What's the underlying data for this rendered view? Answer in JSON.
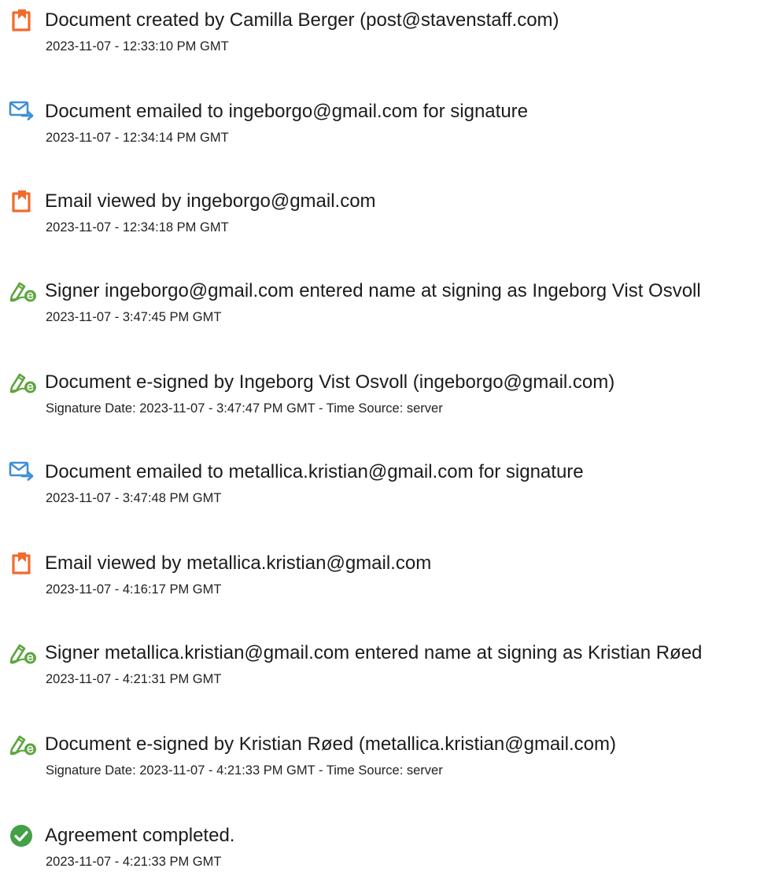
{
  "colors": {
    "doc_icon": "#f26b2c",
    "mail_icon": "#3e8fd6",
    "sign_icon": "#5fa540",
    "check_icon": "#43a047"
  },
  "entries": [
    {
      "icon": "document-icon",
      "title": "Document created by Camilla Berger (post@stavenstaff.com)",
      "detail": "2023-11-07 - 12:33:10 PM GMT"
    },
    {
      "icon": "email-sent-icon",
      "title": "Document emailed to ingeborgo@gmail.com for signature",
      "detail": "2023-11-07 - 12:34:14 PM GMT"
    },
    {
      "icon": "document-icon",
      "title": "Email viewed by ingeborgo@gmail.com",
      "detail": "2023-11-07 - 12:34:18 PM GMT"
    },
    {
      "icon": "esign-pen-icon",
      "title": "Signer ingeborgo@gmail.com entered name at signing as Ingeborg Vist Osvoll",
      "detail": "2023-11-07 - 3:47:45 PM GMT"
    },
    {
      "icon": "esign-pen-icon",
      "title": "Document e-signed by Ingeborg Vist Osvoll (ingeborgo@gmail.com)",
      "detail": "Signature Date: 2023-11-07 - 3:47:47 PM GMT - Time Source: server"
    },
    {
      "icon": "email-sent-icon",
      "title": "Document emailed to metallica.kristian@gmail.com for signature",
      "detail": "2023-11-07 - 3:47:48 PM GMT"
    },
    {
      "icon": "document-icon",
      "title": "Email viewed by metallica.kristian@gmail.com",
      "detail": "2023-11-07 - 4:16:17 PM GMT"
    },
    {
      "icon": "esign-pen-icon",
      "title": "Signer metallica.kristian@gmail.com entered name at signing as Kristian Røed",
      "detail": "2023-11-07 - 4:21:31 PM GMT"
    },
    {
      "icon": "esign-pen-icon",
      "title": "Document e-signed by Kristian Røed (metallica.kristian@gmail.com)",
      "detail": "Signature Date: 2023-11-07 - 4:21:33 PM GMT - Time Source: server"
    },
    {
      "icon": "checkmark-circle-icon",
      "title": "Agreement completed.",
      "detail": "2023-11-07 - 4:21:33 PM GMT"
    }
  ]
}
